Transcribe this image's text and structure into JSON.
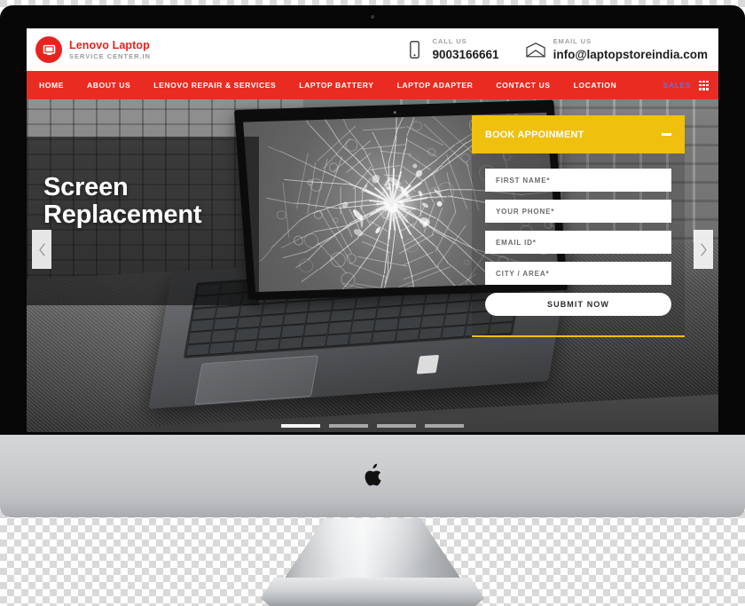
{
  "device": {
    "kind": "imac-desktop-mockup",
    "apple_logo": "apple-logo"
  },
  "header": {
    "logo_icon": "monitor-icon",
    "brand_title": "Lenovo Laptop",
    "brand_subtitle": "SERVICE CENTER.IN",
    "contacts": [
      {
        "icon": "phone-icon",
        "label": "CALL US",
        "value": "9003166661"
      },
      {
        "icon": "envelope-icon",
        "label": "EMAIL US",
        "value": "info@laptopstoreindia.com"
      }
    ]
  },
  "nav": {
    "background_color": "#ea2b22",
    "items": [
      {
        "label": "HOME"
      },
      {
        "label": "ABOUT US"
      },
      {
        "label": "LENOVO REPAIR & SERVICES"
      },
      {
        "label": "LAPTOP BATTERY"
      },
      {
        "label": "LAPTOP ADAPTER"
      },
      {
        "label": "CONTACT US"
      },
      {
        "label": "LOCATION"
      }
    ],
    "sales_label": "SALES",
    "sales_color": "#6b6fd4",
    "grid_icon": "apps-grid-icon"
  },
  "hero": {
    "title_line1": "Screen",
    "title_line2": "Replacement",
    "prev_icon": "chevron-left-icon",
    "next_icon": "chevron-right-icon",
    "slide_count": 4,
    "active_slide": 1,
    "image_alt": "cracked laptop screen on concrete ledge"
  },
  "booking": {
    "title": "BOOK APPOINMENT",
    "collapse_icon": "minus-icon",
    "accent_color": "#efc00e",
    "fields": [
      {
        "placeholder": "FIRST NAME*"
      },
      {
        "placeholder": "YOUR PHONE*"
      },
      {
        "placeholder": "EMAIL ID*"
      },
      {
        "placeholder": "CITY / AREA*"
      }
    ],
    "submit_label": "SUBMIT NOW"
  }
}
